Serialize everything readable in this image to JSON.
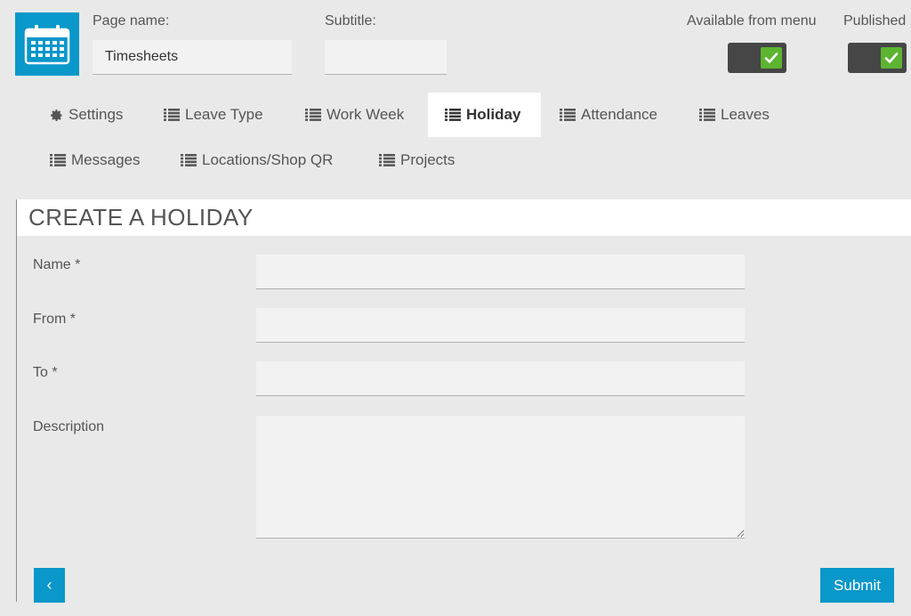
{
  "header": {
    "app_icon": "calendar-icon",
    "page_name_label": "Page name:",
    "page_name_value": "Timesheets",
    "subtitle_label": "Subtitle:",
    "subtitle_value": "",
    "available_label": "Available from menu",
    "published_label": "Published",
    "available_checked": true,
    "published_checked": true
  },
  "tabs": [
    {
      "label": "Settings",
      "icon": "gear-icon",
      "active": false
    },
    {
      "label": "Leave Type",
      "icon": "list-icon",
      "active": false
    },
    {
      "label": "Work Week",
      "icon": "list-icon",
      "active": false
    },
    {
      "label": "Holiday",
      "icon": "list-icon",
      "active": true
    },
    {
      "label": "Attendance",
      "icon": "list-icon",
      "active": false
    },
    {
      "label": "Leaves",
      "icon": "list-icon",
      "active": false
    },
    {
      "label": "Messages",
      "icon": "list-icon",
      "active": false
    },
    {
      "label": "Locations/Shop QR",
      "icon": "list-icon",
      "active": false
    },
    {
      "label": "Projects",
      "icon": "list-icon",
      "active": false
    }
  ],
  "form": {
    "title": "CREATE A HOLIDAY",
    "name_label": "Name *",
    "from_label": "From *",
    "to_label": "To *",
    "description_label": "Description",
    "submit_label": "Submit",
    "back_label": "‹"
  },
  "colors": {
    "accent": "#0a97c9",
    "toggle_on": "#5cb431",
    "toggle_track": "#464646",
    "background": "#e9e9e9"
  }
}
